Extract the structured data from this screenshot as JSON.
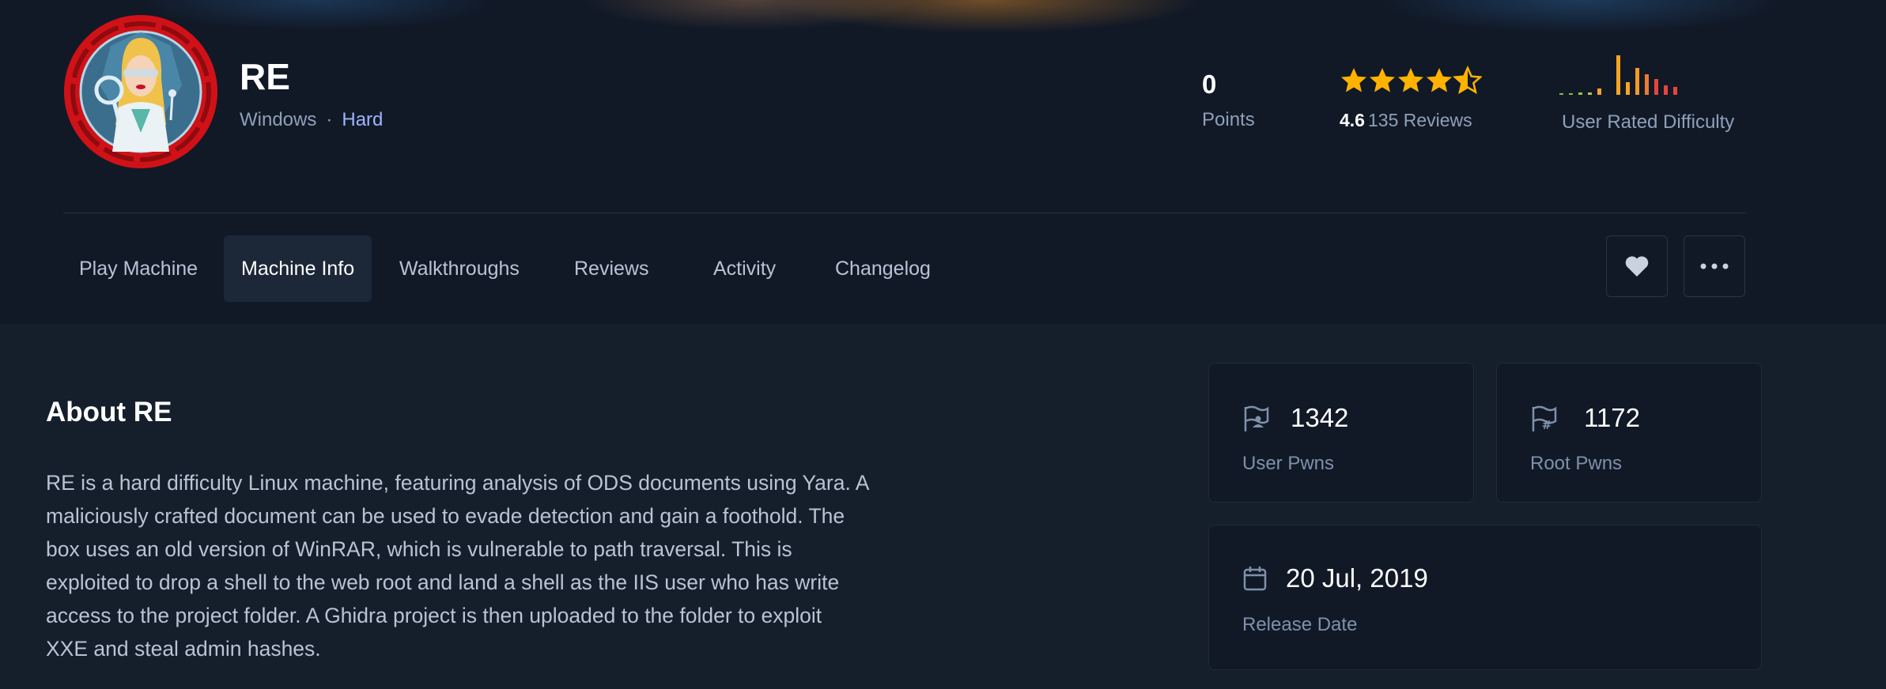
{
  "machine": {
    "name": "RE",
    "os": "Windows",
    "separator": "·",
    "difficulty": "Hard"
  },
  "stats": {
    "points_value": "0",
    "points_label": "Points",
    "rating_value": "4.6",
    "rating_reviews": "135 Reviews",
    "rating_stars": 4.6,
    "difficulty_label": "User Rated Difficulty"
  },
  "tabs": [
    {
      "label": "Play Machine"
    },
    {
      "label": "Machine Info"
    },
    {
      "label": "Walkthroughs"
    },
    {
      "label": "Reviews"
    },
    {
      "label": "Activity"
    },
    {
      "label": "Changelog"
    }
  ],
  "actions": {
    "favorite_icon": "heart-icon",
    "more_icon": "more-horizontal-icon"
  },
  "about": {
    "title": "About RE",
    "text": "RE is a hard difficulty Linux machine, featuring analysis of ODS documents using Yara. A maliciously crafted document can be used to evade detection and gain a foothold. The box uses an old version of WinRAR, which is vulnerable to path traversal. This is exploited to drop a shell to the web root and land a shell as the IIS user who has write access to the project folder. A Ghidra project is then uploaded to the folder to exploit XXE and steal admin hashes."
  },
  "cards": {
    "user_pwns_value": "1342",
    "user_pwns_label": "User Pwns",
    "root_pwns_value": "1172",
    "root_pwns_label": "Root Pwns",
    "release_date_value": "20 Jul, 2019",
    "release_date_label": "Release Date"
  },
  "colors": {
    "star": "#ffb300",
    "difficulty_hard": "#9fb4ff",
    "bar_easy": "#7cc242",
    "bar_medium": "#f5a524",
    "bar_hard": "#e8443a"
  }
}
